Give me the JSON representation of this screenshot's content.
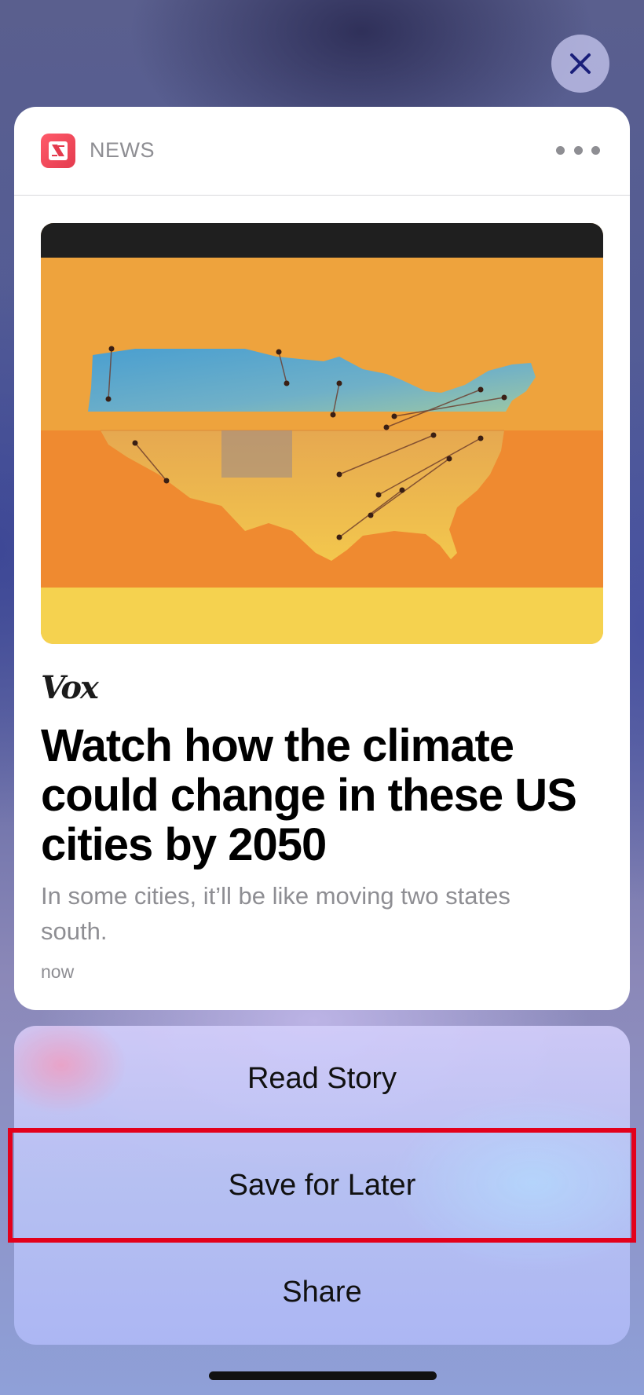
{
  "header": {
    "app_name": "NEWS"
  },
  "article": {
    "publisher": "Vox",
    "headline": "Watch how the climate could change in these US cities by 2050",
    "summary": "In some cities, it’ll be like moving two states south.",
    "timestamp": "now"
  },
  "actions": {
    "read_story": "Read Story",
    "save_for_later": "Save for Later",
    "share": "Share"
  },
  "colors": {
    "highlight": "#e3001b",
    "app_icon": "#ff5a6a"
  },
  "icons": [
    "close-icon",
    "news-app-icon",
    "more-icon"
  ]
}
